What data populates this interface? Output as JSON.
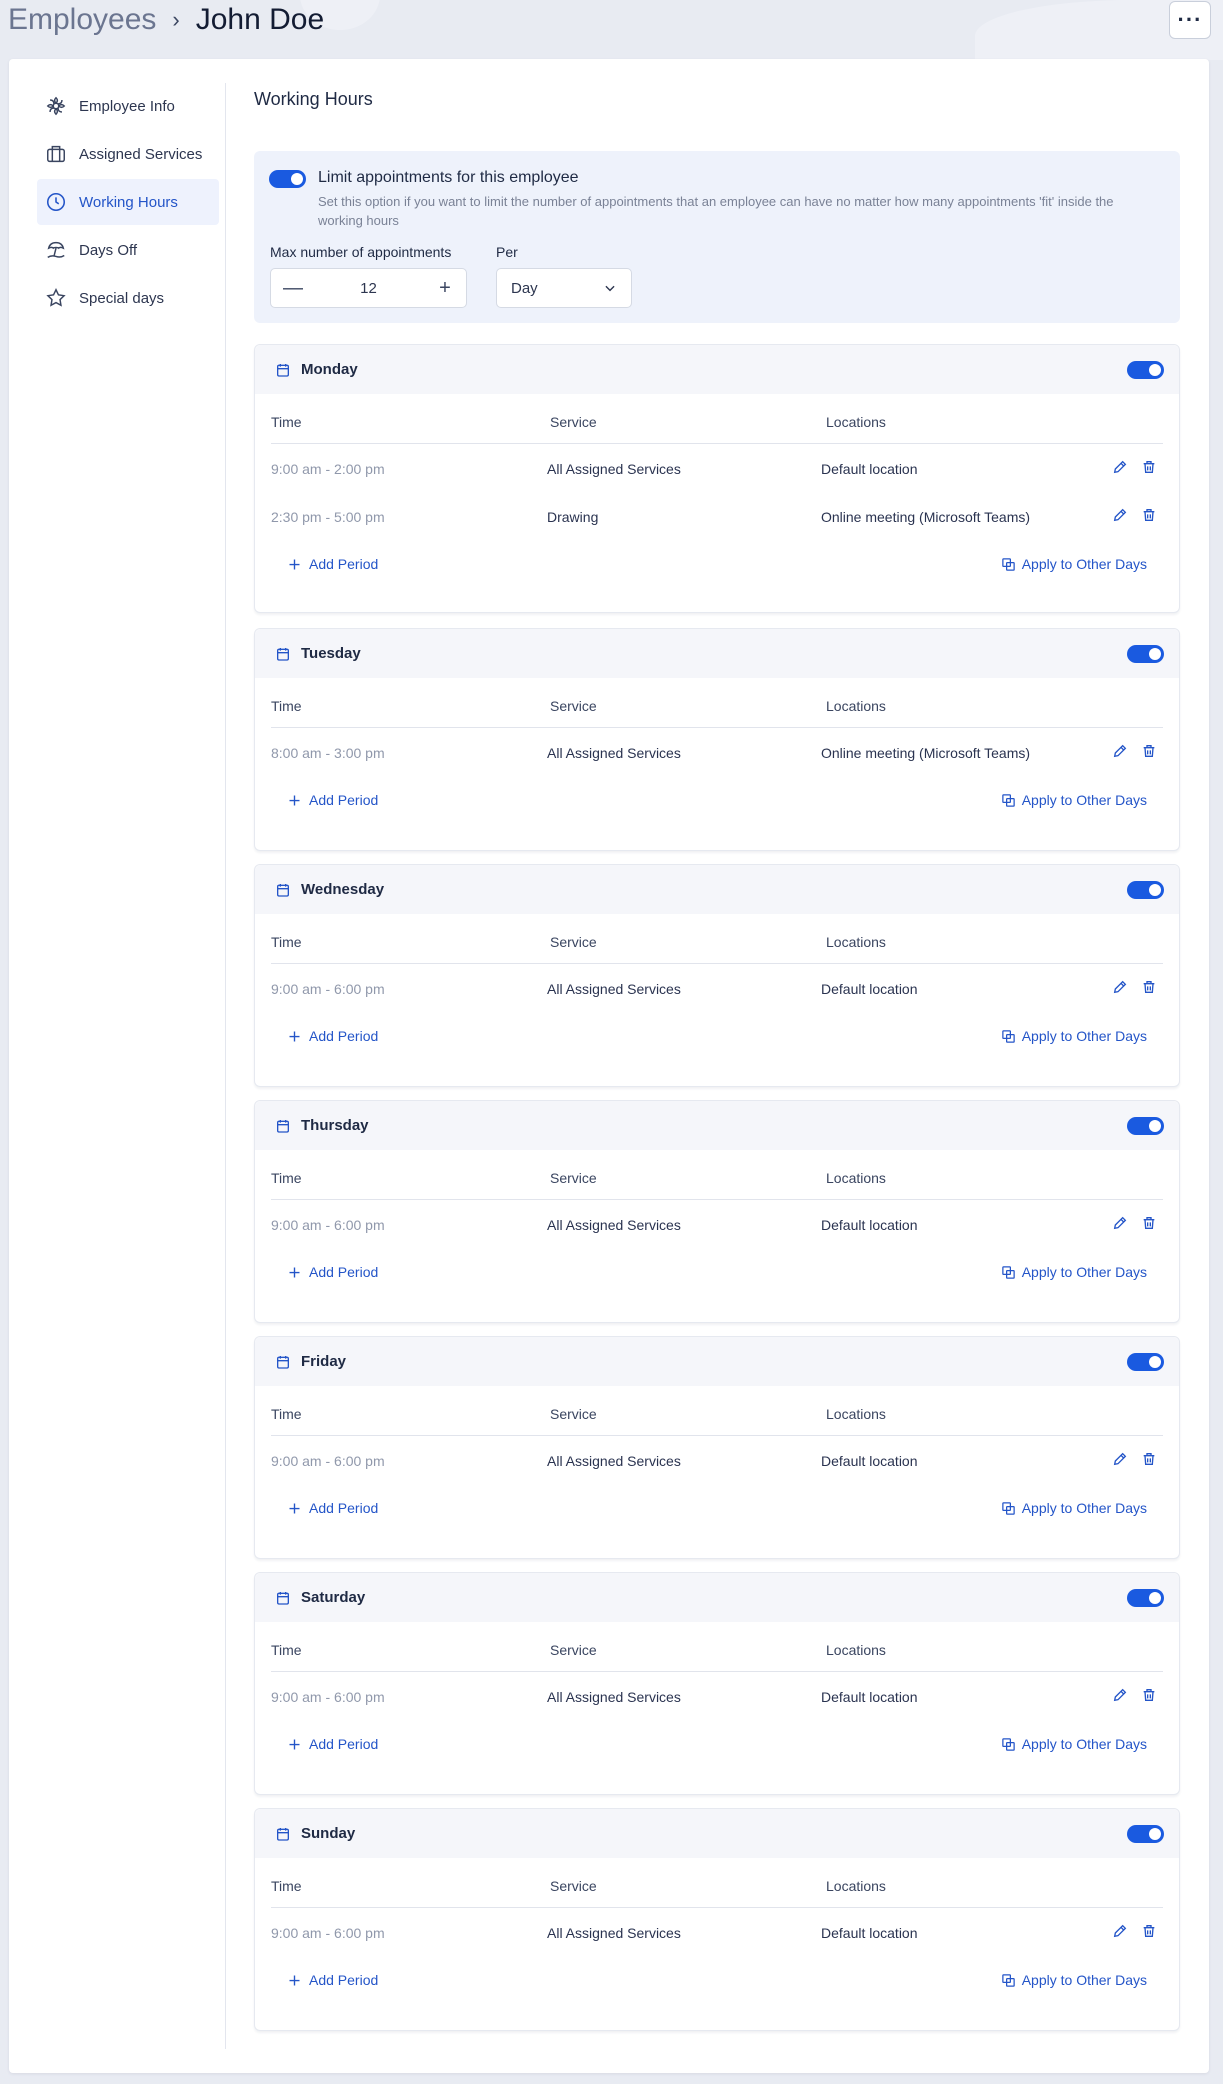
{
  "breadcrumb": {
    "parent": "Employees",
    "separator": "›",
    "current": "John Doe"
  },
  "header": {
    "more_label": "···"
  },
  "sidebar": {
    "items": [
      {
        "label": "Employee Info",
        "icon": "flower-icon",
        "active": false
      },
      {
        "label": "Assigned Services",
        "icon": "briefcase-icon",
        "active": false
      },
      {
        "label": "Working Hours",
        "icon": "clock-icon",
        "active": true
      },
      {
        "label": "Days Off",
        "icon": "beach-umbrella-icon",
        "active": false
      },
      {
        "label": "Special days",
        "icon": "star-icon",
        "active": false
      }
    ]
  },
  "page": {
    "title": "Working Hours"
  },
  "limit": {
    "enabled": true,
    "title": "Limit appointments for this employee",
    "description": "Set this option if you want to limit the number of appointments that an employee can have no matter how many appointments 'fit' inside the working hours",
    "max_label": "Max number of appointments",
    "max_value": "12",
    "minus": "—",
    "plus": "+",
    "per_label": "Per",
    "per_value": "Day"
  },
  "columns": {
    "time": "Time",
    "service": "Service",
    "locations": "Locations"
  },
  "actions": {
    "add_period": "Add Period",
    "apply_other": "Apply to Other Days"
  },
  "colors": {
    "accent": "#1a5ae0",
    "link": "#2455c8",
    "active_bg": "#eef2fd"
  },
  "days": [
    {
      "name": "Monday",
      "enabled": true,
      "periods": [
        {
          "time": "9:00 am - 2:00 pm",
          "service": "All Assigned Services",
          "location": "Default location"
        },
        {
          "time": "2:30 pm - 5:00 pm",
          "service": "Drawing",
          "location": "Online meeting (Microsoft Teams)"
        }
      ]
    },
    {
      "name": "Tuesday",
      "enabled": true,
      "periods": [
        {
          "time": "8:00 am - 3:00 pm",
          "service": "All Assigned Services",
          "location": "Online meeting (Microsoft Teams)"
        }
      ]
    },
    {
      "name": "Wednesday",
      "enabled": true,
      "periods": [
        {
          "time": "9:00 am - 6:00 pm",
          "service": "All Assigned Services",
          "location": "Default location"
        }
      ]
    },
    {
      "name": "Thursday",
      "enabled": true,
      "periods": [
        {
          "time": "9:00 am - 6:00 pm",
          "service": "All Assigned Services",
          "location": "Default location"
        }
      ]
    },
    {
      "name": "Friday",
      "enabled": true,
      "periods": [
        {
          "time": "9:00 am - 6:00 pm",
          "service": "All Assigned Services",
          "location": "Default location"
        }
      ]
    },
    {
      "name": "Saturday",
      "enabled": true,
      "periods": [
        {
          "time": "9:00 am - 6:00 pm",
          "service": "All Assigned Services",
          "location": "Default location"
        }
      ]
    },
    {
      "name": "Sunday",
      "enabled": true,
      "periods": [
        {
          "time": "9:00 am - 6:00 pm",
          "service": "All Assigned Services",
          "location": "Default location"
        }
      ]
    }
  ]
}
